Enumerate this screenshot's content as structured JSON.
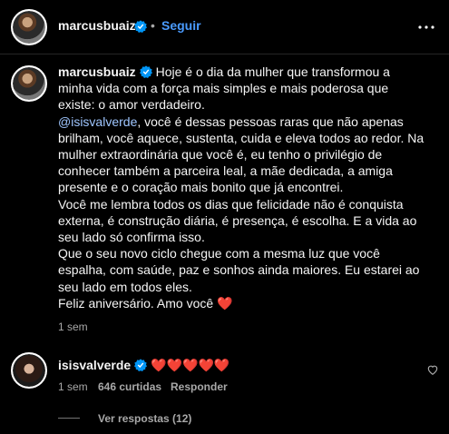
{
  "header": {
    "username": "marcusbuaiz",
    "separator": "•",
    "follow_label": "Seguir",
    "more_icon": "more-horizontal-icon"
  },
  "caption": {
    "username": "marcusbuaiz",
    "paragraph1": "Hoje é o dia da mulher que transformou a minha vida com a força mais simples e mais poderosa que existe: o amor verdadeiro.",
    "mention": "@isisvalverde",
    "paragraph2_rest": ", você é dessas pessoas raras que não apenas brilham, você aquece, sustenta, cuida e eleva todos ao redor. Na mulher extraordinária que você é, eu tenho o privilégio de conhecer também a parceira leal, a mãe dedicada, a amiga presente e o coração mais bonito que já encontrei.",
    "paragraph3": "Você me lembra todos os dias que felicidade não é conquista externa, é construção diária, é presença, é escolha. E a vida ao seu lado só confirma isso.",
    "paragraph4": "Que o seu novo ciclo chegue com a mesma luz que você espalha, com saúde, paz e sonhos ainda maiores. Eu estarei ao seu lado em todos eles.",
    "closing": "Feliz aniversário. Amo você",
    "closing_emoji": "❤️",
    "time": "1 sem"
  },
  "comment": {
    "username": "isisvalverde",
    "text": "❤️❤️❤️❤️❤️",
    "time": "1 sem",
    "likes": "646 curtidas",
    "reply_label": "Responder",
    "view_replies": "Ver respostas (12)"
  },
  "colors": {
    "background": "#000000",
    "text": "#f5f5f5",
    "secondary": "#a8a8a8",
    "follow": "#4a9bff",
    "mention": "#9fc6ff",
    "verified": "#0095f6",
    "heart": "#ff3040"
  }
}
